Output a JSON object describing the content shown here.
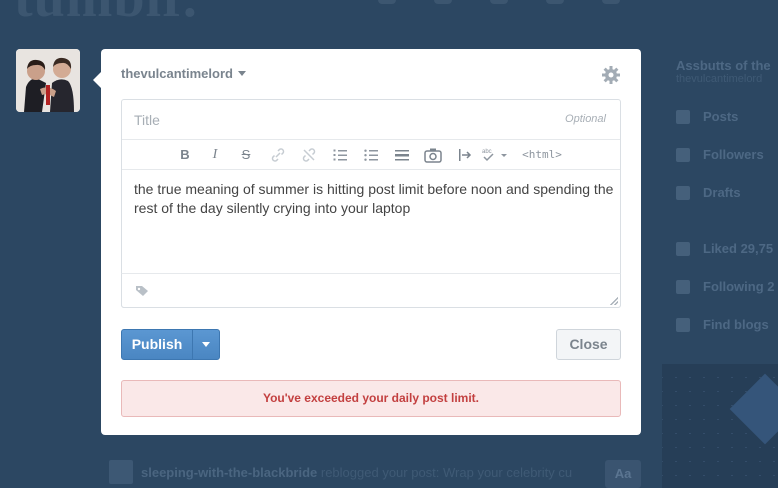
{
  "background": {
    "logo_text": "tumblr."
  },
  "composer": {
    "blog_name": "thevulcantimelord",
    "title_placeholder": "Title",
    "title_optional": "Optional",
    "toolbar": {
      "bold": "B",
      "italic": "I",
      "strike": "S",
      "html": "<html>"
    },
    "body_text": "the true meaning of summer is hitting post limit before noon and spending the rest of the day silently crying into your laptop",
    "publish_label": "Publish",
    "close_label": "Close",
    "error_message": "You've exceeded your daily post limit."
  },
  "sidebar": {
    "blog_title": "Assbutts of the",
    "blog_url": "thevulcantimelord",
    "items": [
      {
        "label": "Posts"
      },
      {
        "label": "Followers"
      },
      {
        "label": "Drafts"
      },
      {
        "label": "Liked 29,75"
      },
      {
        "label": "Following 2"
      },
      {
        "label": "Find blogs"
      }
    ]
  },
  "dashboard_post": {
    "username": "sleeping-with-the-blackbride",
    "text": "reblogged your post: Wrap your celebrity cu",
    "aa_label": "Aa"
  },
  "colors": {
    "dashboard_bg": "#2c4762",
    "accent": "#4a86c2",
    "error_text": "#c34040"
  }
}
